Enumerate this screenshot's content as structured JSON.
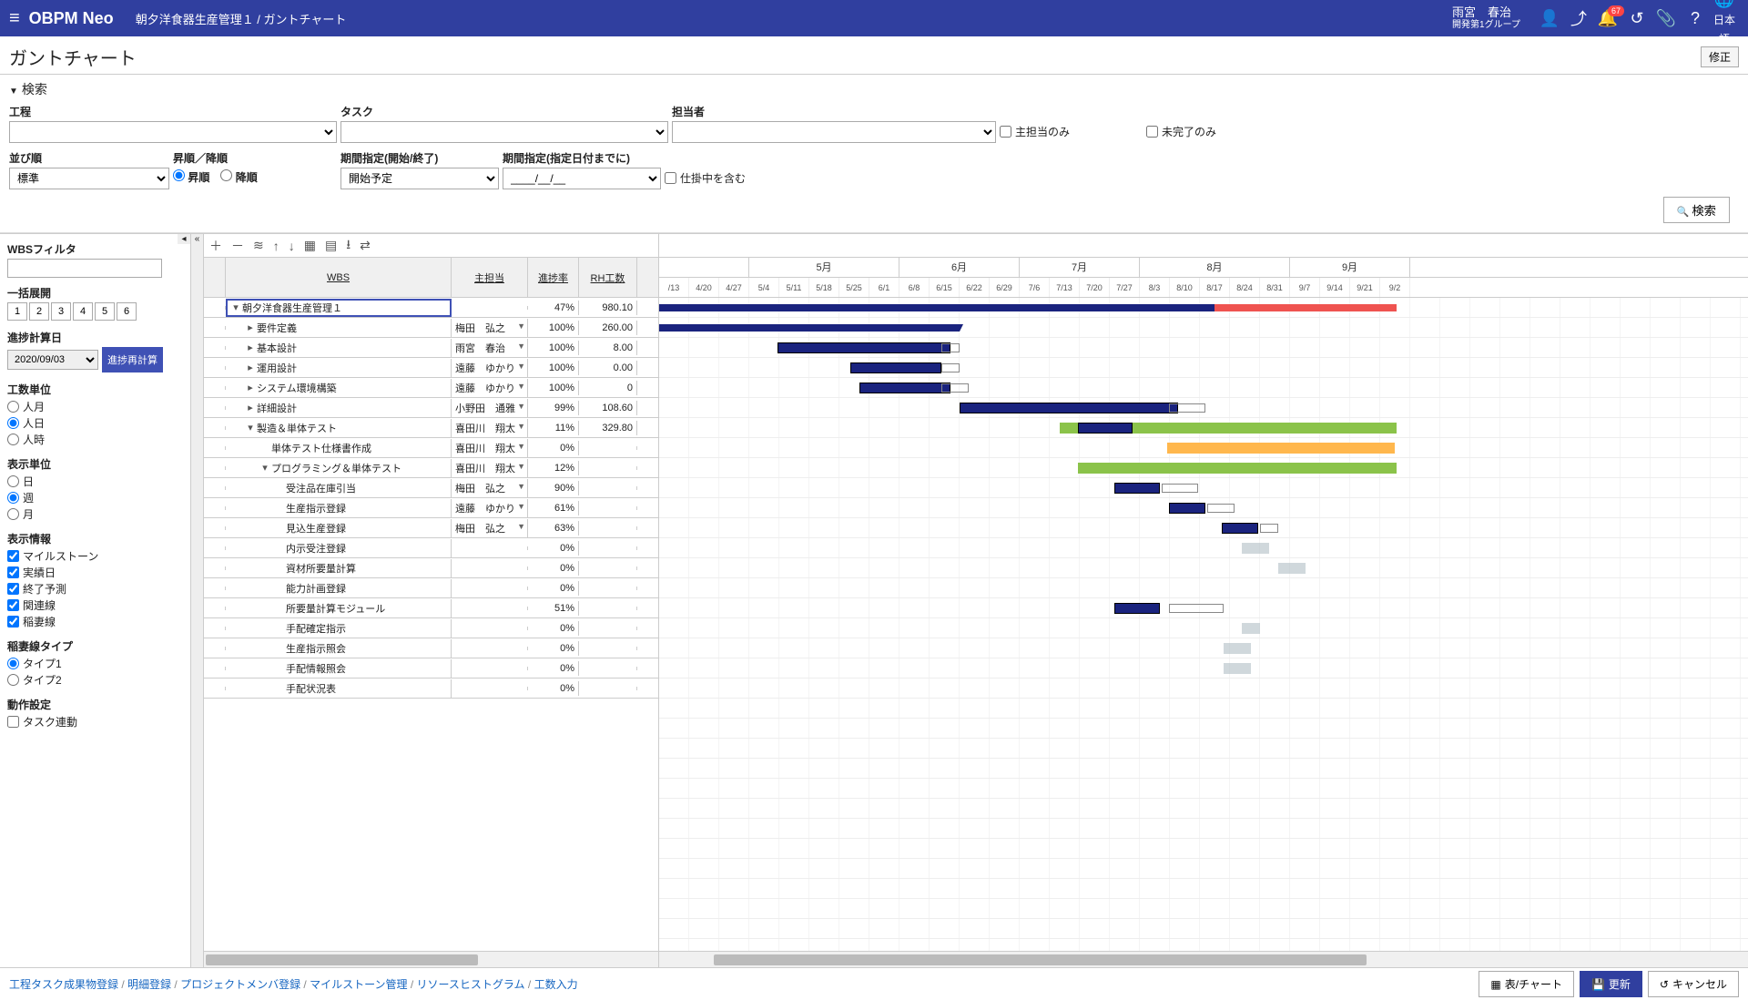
{
  "header": {
    "app": "OBPM Neo",
    "breadcrumb": "朝夕洋食器生産管理１ / ガントチャート",
    "user_name": "雨宮　春治",
    "user_group": "開発第1グループ",
    "badge": "67",
    "lang": "日本語"
  },
  "page": {
    "title": "ガントチャート",
    "fix_btn": "修正"
  },
  "search": {
    "head": "検索",
    "process_label": "工程",
    "task_label": "タスク",
    "assignee_label": "担当者",
    "main_only": "主担当のみ",
    "incomplete_only": "未完了のみ",
    "sort_label": "並び順",
    "sort_value": "標準",
    "order_label": "昇順／降順",
    "order_asc": "昇順",
    "order_desc": "降順",
    "period_kind_label": "期間指定(開始/終了)",
    "period_kind_value": "開始予定",
    "period_until_label": "期間指定(指定日付までに)",
    "period_until_value": "____/__/__",
    "include_wip": "仕掛中を含む",
    "search_btn": "検索"
  },
  "side": {
    "filter_label": "WBSフィルタ",
    "expand_label": "一括展開",
    "levels": [
      "1",
      "2",
      "3",
      "4",
      "5",
      "6"
    ],
    "calc_date_label": "進捗計算日",
    "calc_date": "2020/09/03",
    "recalc_btn": "進捗再計算",
    "unit_label": "工数単位",
    "unit_opts": [
      "人月",
      "人日",
      "人時"
    ],
    "disp_unit_label": "表示単位",
    "disp_unit_opts": [
      "日",
      "週",
      "月"
    ],
    "disp_info_label": "表示情報",
    "disp_info_opts": [
      "マイルストーン",
      "実績日",
      "終了予測",
      "関連線",
      "稲妻線"
    ],
    "bolt_label": "稲妻線タイプ",
    "bolt_opts": [
      "タイプ1",
      "タイプ2"
    ],
    "behav_label": "動作設定",
    "behav_opt": "タスク連動"
  },
  "grid": {
    "col_wbs": "WBS",
    "col_assignee": "主担当",
    "col_rate": "進捗率",
    "col_hours": "RH工数"
  },
  "rows": [
    {
      "ind": 0,
      "tw": "▾",
      "name": "朝夕洋食器生産管理１",
      "asn": "",
      "rate": "47%",
      "hrs": "980.10",
      "sel": true
    },
    {
      "ind": 1,
      "tw": "▸",
      "name": "要件定義",
      "asn": "梅田　弘之",
      "rate": "100%",
      "hrs": "260.00"
    },
    {
      "ind": 1,
      "tw": "▸",
      "name": "基本設計",
      "asn": "雨宮　春治",
      "rate": "100%",
      "hrs": "8.00"
    },
    {
      "ind": 1,
      "tw": "▸",
      "name": "運用設計",
      "asn": "遠藤　ゆかり",
      "rate": "100%",
      "hrs": "0.00"
    },
    {
      "ind": 1,
      "tw": "▸",
      "name": "システム環境構築",
      "asn": "遠藤　ゆかり",
      "rate": "100%",
      "hrs": "0"
    },
    {
      "ind": 1,
      "tw": "▸",
      "name": "詳細設計",
      "asn": "小野田　通雅",
      "rate": "99%",
      "hrs": "108.60"
    },
    {
      "ind": 1,
      "tw": "▾",
      "name": "製造＆単体テスト",
      "asn": "喜田川　翔太",
      "rate": "11%",
      "hrs": "329.80"
    },
    {
      "ind": 2,
      "tw": "",
      "name": "単体テスト仕様書作成",
      "asn": "喜田川　翔太",
      "rate": "0%",
      "hrs": ""
    },
    {
      "ind": 2,
      "tw": "▾",
      "name": "プログラミング＆単体テスト",
      "asn": "喜田川　翔太",
      "rate": "12%",
      "hrs": ""
    },
    {
      "ind": 3,
      "tw": "",
      "name": "受注品在庫引当",
      "asn": "梅田　弘之",
      "rate": "90%",
      "hrs": ""
    },
    {
      "ind": 3,
      "tw": "",
      "name": "生産指示登録",
      "asn": "遠藤　ゆかり",
      "rate": "61%",
      "hrs": ""
    },
    {
      "ind": 3,
      "tw": "",
      "name": "見込生産登録",
      "asn": "梅田　弘之",
      "rate": "63%",
      "hrs": ""
    },
    {
      "ind": 3,
      "tw": "",
      "name": "内示受注登録",
      "asn": "",
      "rate": "0%",
      "hrs": ""
    },
    {
      "ind": 3,
      "tw": "",
      "name": "資材所要量計算",
      "asn": "",
      "rate": "0%",
      "hrs": ""
    },
    {
      "ind": 3,
      "tw": "",
      "name": "能力計画登録",
      "asn": "",
      "rate": "0%",
      "hrs": ""
    },
    {
      "ind": 3,
      "tw": "",
      "name": "所要量計算モジュール",
      "asn": "",
      "rate": "51%",
      "hrs": ""
    },
    {
      "ind": 3,
      "tw": "",
      "name": "手配確定指示",
      "asn": "",
      "rate": "0%",
      "hrs": ""
    },
    {
      "ind": 3,
      "tw": "",
      "name": "生産指示照会",
      "asn": "",
      "rate": "0%",
      "hrs": ""
    },
    {
      "ind": 3,
      "tw": "",
      "name": "手配情報照会",
      "asn": "",
      "rate": "0%",
      "hrs": ""
    },
    {
      "ind": 3,
      "tw": "",
      "name": "手配状況表",
      "asn": "",
      "rate": "0%",
      "hrs": ""
    }
  ],
  "timeline": {
    "months": [
      {
        "label": "5月",
        "weeks": 5
      },
      {
        "label": "6月",
        "weeks": 4
      },
      {
        "label": "7月",
        "weeks": 4
      },
      {
        "label": "8月",
        "weeks": 5
      },
      {
        "label": "9月",
        "weeks": 4
      }
    ],
    "weeks": [
      "/13",
      "4/20",
      "4/27",
      "5/4",
      "5/11",
      "5/18",
      "5/25",
      "6/1",
      "6/8",
      "6/15",
      "6/22",
      "6/29",
      "7/6",
      "7/13",
      "7/20",
      "7/27",
      "8/3",
      "8/10",
      "8/17",
      "8/24",
      "8/31",
      "9/7",
      "9/14",
      "9/21",
      "9/2"
    ]
  },
  "footer": {
    "links": [
      "工程タスク成果物登録",
      "明細登録",
      "プロジェクトメンバ登録",
      "マイルストーン管理",
      "リソースヒストグラム",
      "工数入力"
    ],
    "table_chart": "表/チャート",
    "update": "更新",
    "cancel": "キャンセル"
  }
}
